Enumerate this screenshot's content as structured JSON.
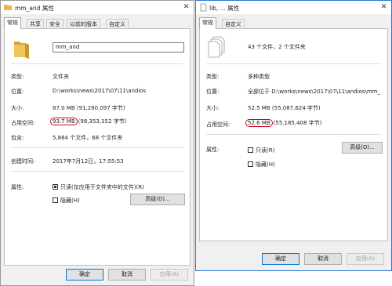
{
  "dialog1": {
    "title": "mm_and 属性",
    "tabs": [
      "常规",
      "共享",
      "安全",
      "以前的版本",
      "自定义"
    ],
    "name_value": "mm_and",
    "rows": {
      "type": {
        "label": "类型:",
        "value": "文件夹"
      },
      "location": {
        "label": "位置:",
        "value": "D:\\works\\news\\2017\\07\\11\\andios"
      },
      "size": {
        "label": "大小:",
        "value": "87.0 MB (91,280,097 字节)"
      },
      "disk_size": {
        "label": "占用空间:",
        "highlight": "93.7 MB",
        "value": "(98,353,152 字节)"
      },
      "contains": {
        "label": "包含:",
        "value": "5,884 个文件，68 个文件夹"
      },
      "created": {
        "label": "创建时间:",
        "value": "2017年7月12日，17:55:53"
      },
      "attributes": {
        "label": "属性:"
      }
    },
    "readonly_label": "只读(仅应用于文件夹中的文件)(R)",
    "hidden_label": "隐藏(H)",
    "advanced_button": "高级(D)...",
    "buttons": {
      "ok": "确定",
      "cancel": "取消",
      "apply": "应用(A)"
    }
  },
  "dialog2": {
    "title": "lib, ... 属性",
    "tabs": [
      "常规",
      "自定义"
    ],
    "summary": "43 个文件，2 个文件夹",
    "rows": {
      "type": {
        "label": "类型:",
        "value": "多种类型"
      },
      "location": {
        "label": "位置:",
        "value": "全部位于 D:\\works\\news\\2017\\07\\11\\andios\\mm_"
      },
      "size": {
        "label": "大小:",
        "value": "52.5 MB (55,087,624 字节)"
      },
      "disk_size": {
        "label": "占用空间:",
        "highlight": "52.6 MB",
        "value": "(55,185,408 字节)"
      },
      "attributes": {
        "label": "属性:"
      }
    },
    "readonly_label": "只读(R)",
    "hidden_label": "隐藏(H)",
    "advanced_button": "高级(D)...",
    "buttons": {
      "ok": "确定",
      "cancel": "取消",
      "apply": "应用(A)"
    }
  },
  "window_controls": {
    "close": "✕"
  },
  "colors": {
    "highlight_ring": "#d0021b",
    "active_border": "#2b78d4",
    "folder": "#e8b84a"
  },
  "icons": [
    "folder-icon",
    "multiple-files-icon",
    "close-icon",
    "title-folder-icon",
    "title-file-icon"
  ]
}
